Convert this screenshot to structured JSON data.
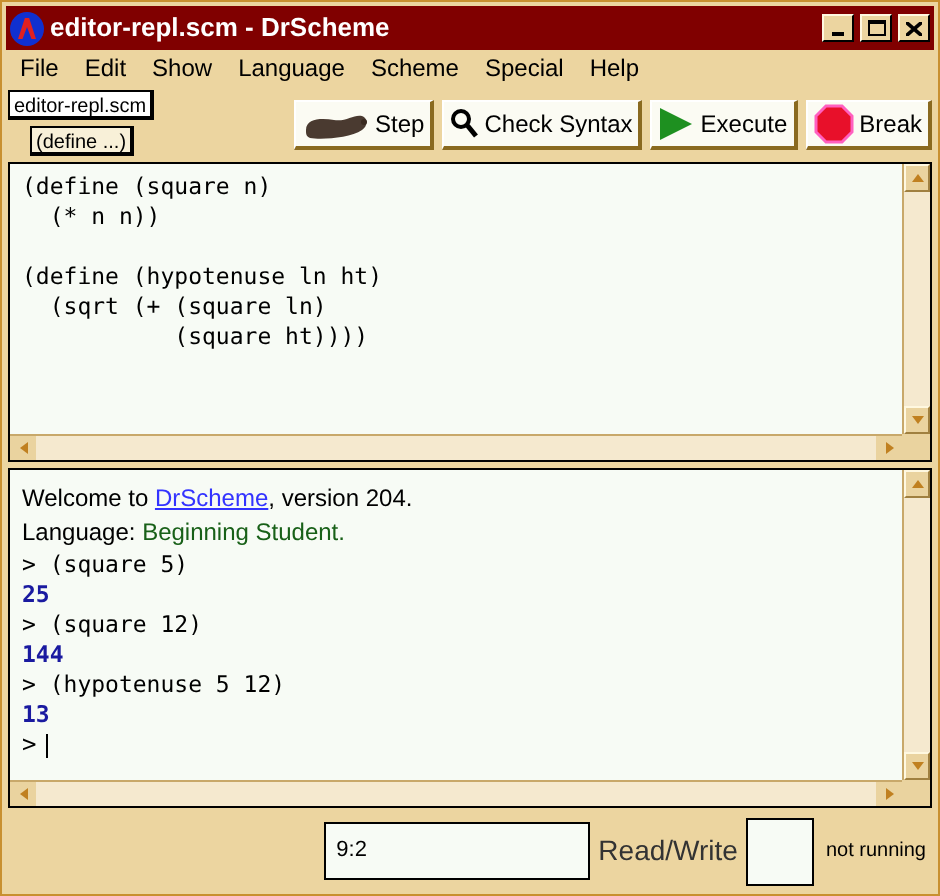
{
  "window": {
    "title": "editor-repl.scm - DrScheme"
  },
  "menu": [
    "File",
    "Edit",
    "Show",
    "Language",
    "Scheme",
    "Special",
    "Help"
  ],
  "file_tab": "editor-repl.scm",
  "define_button": "(define ...)",
  "toolbar": [
    {
      "kind": "step",
      "label": "Step"
    },
    {
      "kind": "check",
      "label": "Check Syntax"
    },
    {
      "kind": "execute",
      "label": "Execute"
    },
    {
      "kind": "break",
      "label": "Break"
    }
  ],
  "editor": {
    "blocks": [
      [
        "(define (square n)",
        "  (* n n))"
      ],
      [
        "(define (hypotenuse ln ht)",
        "  (sqrt (+ (square ln)",
        "           (square ht))))"
      ]
    ]
  },
  "repl": {
    "lines": [
      {
        "kind": "welcome",
        "parts": [
          "Welcome to ",
          "DrScheme",
          ", version 204."
        ]
      },
      {
        "kind": "language",
        "parts": [
          "Language: ",
          "Beginning Student."
        ]
      },
      {
        "kind": "input",
        "text": "> (square 5)"
      },
      {
        "kind": "output",
        "text": "25"
      },
      {
        "kind": "input",
        "text": "> (square 12)"
      },
      {
        "kind": "output",
        "text": "144"
      },
      {
        "kind": "input",
        "text": "> (hypotenuse 5 12)"
      },
      {
        "kind": "output",
        "text": "13"
      },
      {
        "kind": "prompt",
        "text": ">"
      }
    ]
  },
  "status_bar": {
    "position": "9:2",
    "mode": "Read/Write",
    "state": "not running"
  }
}
